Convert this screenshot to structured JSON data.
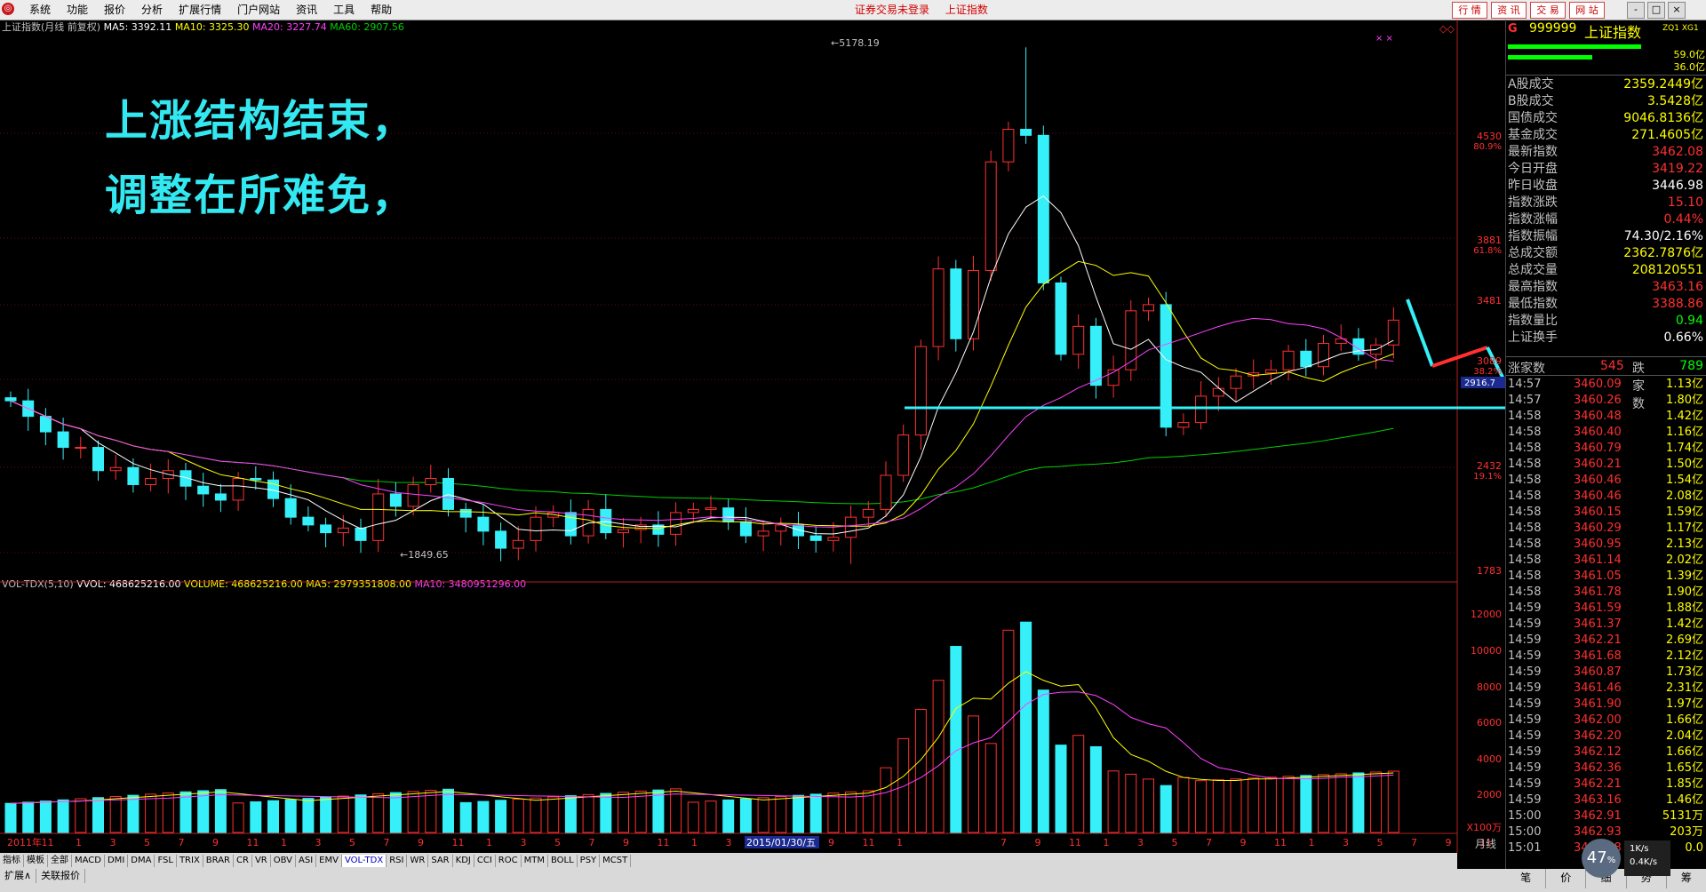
{
  "menu": [
    "系统",
    "功能",
    "报价",
    "分析",
    "扩展行情",
    "门户网站",
    "资讯",
    "工具",
    "帮助"
  ],
  "top_status": [
    "证券交易未登录",
    "上证指数"
  ],
  "right_buttons": [
    "行 情",
    "资 讯",
    "交 易",
    "网 站"
  ],
  "window_controls": [
    "-",
    "□",
    "×"
  ],
  "chart_header": {
    "title": "上证指数(月线 前复权)",
    "ma5": "MA5: 3392.11",
    "ma10": "MA10: 3325.30",
    "ma20": "MA20: 3227.74",
    "ma60": "MA60: 2907.56"
  },
  "volume_header": {
    "name": "VOL-TDX(5,10)",
    "vvol": "VVOL: 468625216.00",
    "volume": "VOLUME: 468625216.00",
    "ma5": "MA5: 2979351808.00",
    "ma10": "MA10: 3480951296.00"
  },
  "annotation": {
    "line1": "上涨结构结束，",
    "line2": "调整在所难免，"
  },
  "price_marks": {
    "high": "5178.19",
    "low": "1849.65",
    "current_tag": "2916.7"
  },
  "price_axis": [
    {
      "value": "4530",
      "pct": "80.9%"
    },
    {
      "value": "3881",
      "pct": "61.8%"
    },
    {
      "value": "3481",
      "pct": ""
    },
    {
      "value": "3089",
      "pct": "38.2%"
    },
    {
      "value": "2432",
      "pct": "19.1%"
    },
    {
      "value": "1783",
      "pct": ""
    }
  ],
  "volume_axis": [
    "12000",
    "10000",
    "8000",
    "6000",
    "4000",
    "2000",
    "X100万"
  ],
  "time_axis": [
    "2011年",
    "11",
    "1",
    "3",
    "5",
    "7",
    "9",
    "11",
    "1",
    "3",
    "5",
    "7",
    "9",
    "11",
    "1",
    "3",
    "5",
    "7",
    "9",
    "11",
    "1",
    "3",
    "5",
    "7",
    "9",
    "11",
    "1",
    "2015/01/30/五",
    "7",
    "9",
    "11",
    "1",
    "3",
    "5",
    "7",
    "9",
    "11",
    "1",
    "3",
    "5",
    "7",
    "9",
    "11",
    "1"
  ],
  "period_label": "月线",
  "indicator_tabs": [
    "指标",
    "模板",
    "全部",
    "MACD",
    "DMI",
    "DMA",
    "FSL",
    "TRIX",
    "BRAR",
    "CR",
    "VR",
    "OBV",
    "ASI",
    "EMV",
    "VOL-TDX",
    "RSI",
    "WR",
    "SAR",
    "KDJ",
    "CCI",
    "ROC",
    "MTM",
    "BOLL",
    "PSY",
    "MCST"
  ],
  "active_tab": "VOL-TDX",
  "bottom_tabs": [
    "扩展∧",
    "关联报价"
  ],
  "right_panel": {
    "flag": "G",
    "code": "999999",
    "name": "上证指数",
    "tag": "ZQ1 XG1",
    "bar_values": [
      "59.0亿",
      "36.0亿"
    ],
    "stats": [
      {
        "k": "A股成交",
        "v": "2359.2449亿",
        "c": "#ffff00"
      },
      {
        "k": "B股成交",
        "v": "3.5428亿",
        "c": "#ffff00"
      },
      {
        "k": "国债成交",
        "v": "9046.8136亿",
        "c": "#ffff00"
      },
      {
        "k": "基金成交",
        "v": "271.4605亿",
        "c": "#ffff00"
      },
      {
        "k": "最新指数",
        "v": "3462.08",
        "c": "#ff3030"
      },
      {
        "k": "今日开盘",
        "v": "3419.22",
        "c": "#ff3030"
      },
      {
        "k": "昨日收盘",
        "v": "3446.98",
        "c": "#ffffff"
      },
      {
        "k": "指数涨跌",
        "v": "15.10",
        "c": "#ff3030"
      },
      {
        "k": "指数涨幅",
        "v": "0.44%",
        "c": "#ff3030"
      },
      {
        "k": "指数振幅",
        "v": "74.30/2.16%",
        "c": "#ffffff"
      },
      {
        "k": "总成交额",
        "v": "2362.7876亿",
        "c": "#ffff00"
      },
      {
        "k": "总成交量",
        "v": "208120551",
        "c": "#ffff00"
      },
      {
        "k": "最高指数",
        "v": "3463.16",
        "c": "#ff3030"
      },
      {
        "k": "最低指数",
        "v": "3388.86",
        "c": "#ff3030"
      },
      {
        "k": "指数量比",
        "v": "0.94",
        "c": "#00ff00"
      },
      {
        "k": "上证换手",
        "v": "0.66%",
        "c": "#ffffff"
      }
    ],
    "up_label": "涨家数",
    "up_count": "545",
    "down_label": "跌家数",
    "down_count": "789",
    "ticks": [
      [
        "14:57",
        "3460.09",
        "1.13亿"
      ],
      [
        "14:57",
        "3460.26",
        "1.80亿"
      ],
      [
        "14:58",
        "3460.48",
        "1.42亿"
      ],
      [
        "14:58",
        "3460.40",
        "1.16亿"
      ],
      [
        "14:58",
        "3460.79",
        "1.74亿"
      ],
      [
        "14:58",
        "3460.21",
        "1.50亿"
      ],
      [
        "14:58",
        "3460.46",
        "1.54亿"
      ],
      [
        "14:58",
        "3460.46",
        "2.08亿"
      ],
      [
        "14:58",
        "3460.15",
        "1.59亿"
      ],
      [
        "14:58",
        "3460.29",
        "1.17亿"
      ],
      [
        "14:58",
        "3460.95",
        "2.13亿"
      ],
      [
        "14:58",
        "3461.14",
        "2.02亿"
      ],
      [
        "14:58",
        "3461.05",
        "1.39亿"
      ],
      [
        "14:58",
        "3461.78",
        "1.90亿"
      ],
      [
        "14:59",
        "3461.59",
        "1.88亿"
      ],
      [
        "14:59",
        "3461.37",
        "1.42亿"
      ],
      [
        "14:59",
        "3462.21",
        "2.69亿"
      ],
      [
        "14:59",
        "3461.68",
        "2.12亿"
      ],
      [
        "14:59",
        "3460.87",
        "1.73亿"
      ],
      [
        "14:59",
        "3461.46",
        "2.31亿"
      ],
      [
        "14:59",
        "3461.90",
        "1.97亿"
      ],
      [
        "14:59",
        "3462.00",
        "1.66亿"
      ],
      [
        "14:59",
        "3462.20",
        "2.04亿"
      ],
      [
        "14:59",
        "3462.12",
        "1.66亿"
      ],
      [
        "14:59",
        "3462.36",
        "1.65亿"
      ],
      [
        "14:59",
        "3462.21",
        "1.85亿"
      ],
      [
        "14:59",
        "3463.16",
        "1.46亿"
      ],
      [
        "15:00",
        "3462.91",
        "5131万"
      ],
      [
        "15:00",
        "3462.93",
        "203万"
      ],
      [
        "15:01",
        "3462.08",
        "0.0"
      ]
    ],
    "bottom_tabs": [
      "笔",
      "价",
      "细",
      "势",
      "筹"
    ]
  },
  "net_monitor": {
    "percent": "47",
    "unit": "%",
    "up": "1K/s",
    "down": "0.4K/s"
  },
  "colors": {
    "up": "#ff3030",
    "down": "#35f0f8",
    "ma5": "#ffffff",
    "ma10": "#ffff00",
    "ma20": "#ff40ff",
    "ma60": "#00d000",
    "annotation": "#33e8f0"
  }
}
